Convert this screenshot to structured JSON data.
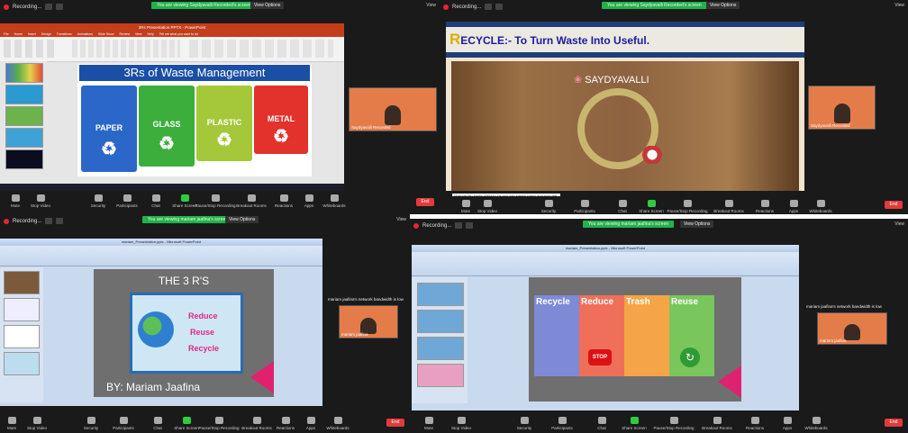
{
  "toolbar": {
    "recording": "Recording...",
    "view_options": "View Options",
    "view": "View",
    "end": "End",
    "buttons": [
      "Mute",
      "Stop Video",
      "Security",
      "Participants",
      "Chat",
      "Share Screen",
      "Pause/Stop Recording",
      "Breakout Rooms",
      "Reactions",
      "Apps",
      "Whiteboards"
    ]
  },
  "q1": {
    "banner": "You are viewing Saydyavalli Recorded's screen",
    "ppt_title": "3Rs Presentation.PPTX - PowerPoint",
    "ribbon_tabs": [
      "File",
      "Home",
      "Insert",
      "Design",
      "Transitions",
      "Animations",
      "Slide Show",
      "Review",
      "View",
      "Help",
      "Tell me what you want to do"
    ],
    "slide_title": "3Rs of Waste Management",
    "bins": [
      "PAPER",
      "GLASS",
      "PLASTIC",
      "METAL"
    ],
    "participant": "Saydyavalli Recorded",
    "status": "Slide 1 of 5"
  },
  "q2": {
    "banner": "You are viewing Saydyavalli Recorded's screen",
    "slide_title_first": "R",
    "slide_title": "ECYCLE:- To Turn Waste Into Useful.",
    "author": "SAYDYAVALLI",
    "participant": "Saydyavalli Recorded",
    "chat_note": "[Aarodh My Aadia (AM+4): Or you can simply press and hold the space bar to temporarily unmute]"
  },
  "q3": {
    "banner": "You are viewing mariam jaafina's screen",
    "ppt_title": "mariam_Presentation.pptx - Microsoft PowerPoint",
    "slide_title": "THE 3 R'S",
    "words": [
      "Reduce",
      "Reuse",
      "Recycle"
    ],
    "byline": "BY: Mariam Jaafina",
    "bandwidth": "mariam jaafina's network bandwidth is low",
    "participant": "mariam jaafina"
  },
  "q4": {
    "banner": "You are viewing mariam jaafina's screen",
    "ppt_title": "mariam_Presentation.pptx - Microsoft PowerPoint",
    "columns": [
      "Recycle",
      "Reduce",
      "Trash",
      "Reuse"
    ],
    "stop": "STOP",
    "bandwidth": "mariam jaafina's network bandwidth is low",
    "participant": "mariam jaafina"
  }
}
